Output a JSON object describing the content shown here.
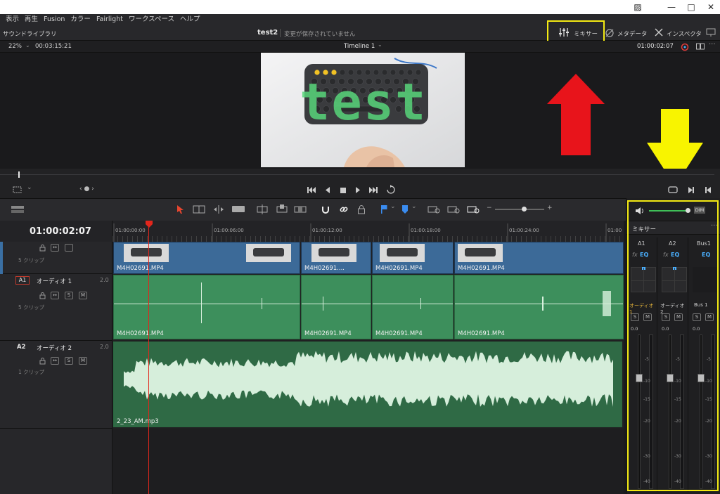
{
  "menu": [
    "表示",
    "再生",
    "Fusion",
    "カラー",
    "Fairlight",
    "ワークスペース",
    "ヘルプ"
  ],
  "header": {
    "left_panel": "サウンドライブラリ",
    "project_name": "test2",
    "save_status": "変更が保存されていません",
    "mixer_label": "ミキサー",
    "metadata_label": "メタデータ",
    "inspector_label": "インスペクタ"
  },
  "viewer": {
    "zoom": "22%",
    "duration": "00:03:15:21",
    "timeline_name": "Timeline 1",
    "timecode": "01:00:02:07",
    "overlay_text": "test"
  },
  "timeline": {
    "timecode": "01:00:02:07",
    "ruler": [
      "01:00:00:00",
      "01:00:06:00",
      "01:00:12:00",
      "01:00:18:00",
      "01:00:24:00",
      "01:00"
    ],
    "video_track": {
      "clip_count": "5 クリップ"
    },
    "video_clips": [
      "M4H02691.MP4",
      "M4H02691....",
      "M4H02691.MP4",
      "M4H02691.MP4"
    ],
    "audio1": {
      "id": "A1",
      "name": "オーディオ 1",
      "channel": "2.0",
      "clip_count": "5 クリップ",
      "solo": "S",
      "mute": "M"
    },
    "audio1_clips": [
      "M4H02691.MP4",
      "M4H02691.MP4",
      "M4H02691.MP4",
      "M4H02691.MP4"
    ],
    "audio2": {
      "id": "A2",
      "name": "オーディオ 2",
      "channel": "2.0",
      "clip_count": "1 クリップ",
      "solo": "S",
      "mute": "M"
    },
    "audio2_clip": "2_23_AM.mp3"
  },
  "mixer": {
    "dim": "DIM",
    "title": "ミキサー",
    "channels": [
      {
        "id": "A1",
        "name": "オーディオ 1",
        "fx": "fx",
        "eq": "EQ",
        "solo": "S",
        "mute": "M",
        "level": "0.0"
      },
      {
        "id": "A2",
        "name": "オーディオ 2",
        "fx": "fx",
        "eq": "EQ",
        "solo": "S",
        "mute": "M",
        "level": "0.0"
      },
      {
        "id": "Bus1",
        "name": "Bus 1",
        "fx": "",
        "eq": "EQ",
        "solo": "S",
        "mute": "M",
        "level": "0.0"
      }
    ],
    "scale": [
      "-5",
      "-10",
      "-15",
      "-20",
      "-30",
      "-40"
    ]
  },
  "colors": {
    "highlight_box": "#f4ea13",
    "red_arrow": "#e8141b",
    "yellow_arrow": "#f8f400",
    "video_clip": "#3c6a98",
    "audio_clip": "#3d8f5c",
    "playhead": "#e2261c"
  }
}
